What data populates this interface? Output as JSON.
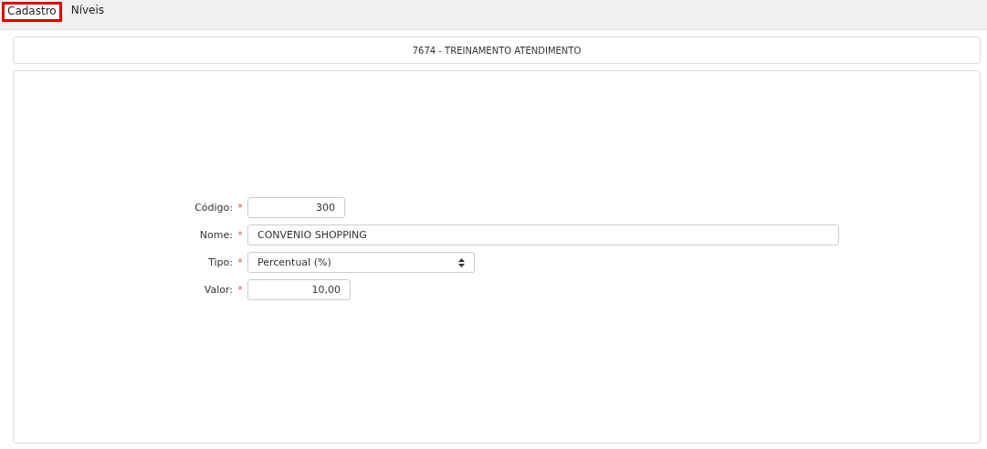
{
  "tabs": [
    {
      "label": "Cadastro",
      "selected": true
    },
    {
      "label": "Níveis",
      "selected": false
    }
  ],
  "header": {
    "title": "7674 - TREINAMENTO ATENDIMENTO"
  },
  "form": {
    "fields": [
      {
        "label": "Código:",
        "required_mark": "*",
        "kind": "number",
        "value": "300"
      },
      {
        "label": "Nome:",
        "required_mark": "*",
        "kind": "text",
        "value": "CONVENIO SHOPPING"
      },
      {
        "label": "Tipo:",
        "required_mark": "*",
        "kind": "select",
        "value": "Percentual (%)"
      },
      {
        "label": "Valor:",
        "required_mark": "*",
        "kind": "number",
        "value": "10,00"
      }
    ]
  }
}
